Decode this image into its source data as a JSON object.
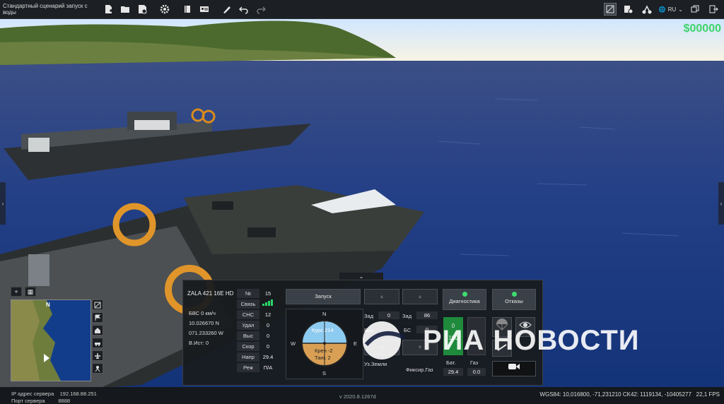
{
  "app": {
    "scenario_title": "Стандартный сценарий запуск с воды"
  },
  "toolbar": {
    "icons": [
      "new-file",
      "open-folder",
      "save-file",
      "settings-gear",
      "book",
      "person-card",
      "brush",
      "undo",
      "redo"
    ],
    "right_icons": [
      "map-mode",
      "layers",
      "drone-tool"
    ],
    "language": "RU"
  },
  "money": "$00000",
  "minimap": {
    "north_label": "N"
  },
  "panel": {
    "uav_name": "ZALA 421 16E HD",
    "telemetry": [
      "БВС 0 км/ч",
      "10.026670 N",
      "071.233260 W",
      "В.Ист: 0"
    ],
    "params": [
      {
        "label": "№",
        "value": "15"
      },
      {
        "label": "Связь",
        "value": ""
      },
      {
        "label": "СНС",
        "value": "12"
      },
      {
        "label": "Удал",
        "value": "0"
      },
      {
        "label": "Выс",
        "value": "0"
      },
      {
        "label": "Скор",
        "value": "0"
      },
      {
        "label": "Напр",
        "value": "29.4"
      },
      {
        "label": "Реж",
        "value": "П/А"
      }
    ],
    "launch_button": "Запуск",
    "diagnostics_button": "Диагностика",
    "failures_button": "Отказы",
    "compass": {
      "n": "N",
      "s": "S",
      "w": "W",
      "e": "E",
      "course": "Курс 214",
      "roll": "Крен -2",
      "pitch": "Танг. 2"
    },
    "zad1": {
      "label": "Зад",
      "value": "0"
    },
    "zad2": {
      "label": "Зад",
      "value": "86"
    },
    "row2_left_label": "Выс",
    "row2_right_label": "БС",
    "row2_right_value": "0",
    "fuel_value": "0",
    "fuel_pct": "100",
    "bottom_labels": {
      "land": "Уз.Земли",
      "fix": "Фиксир.Газ"
    },
    "bat_label": "Бат.",
    "bat_value": "29.4",
    "gas_label": "Газ",
    "gas_value": "0.0"
  },
  "watermark": "РИА НОВОСТИ",
  "footer": {
    "ip_label": "IP адрес сервера",
    "ip_value": "192.168.88.251",
    "port_label": "Порт сервера",
    "port_value": "8888",
    "version": "v 2020.8.1267d",
    "coords": "WGS84: 10,016800, -71,231210 CK42: 1119134, -10405277",
    "fps": "22,1 FPS"
  }
}
